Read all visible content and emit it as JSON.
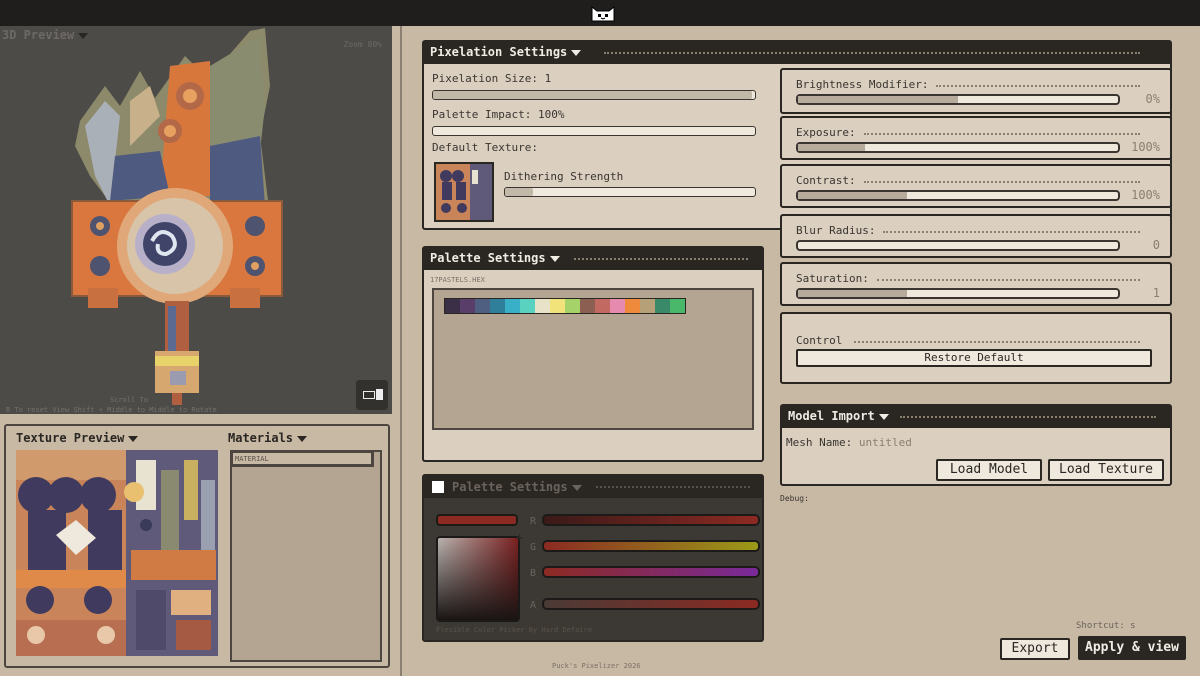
{
  "preview3d": {
    "title": "3D Preview",
    "zoom": "Zoom 80%",
    "hint_line1": "Scroll To",
    "hint_line2": "R To reset View   Shift + Middle to     Middle to Rotate"
  },
  "texture_preview": {
    "title": "Texture Preview"
  },
  "materials": {
    "title": "Materials",
    "items": [
      "MATERIAL"
    ]
  },
  "pixelation": {
    "title": "Pixelation Settings",
    "size_label": "Pixelation Size: 1",
    "palette_impact_label": "Palette Impact: 100%",
    "default_texture_label": "Default Texture:",
    "dithering_label": "Dithering Strength",
    "size_fill": 0.99,
    "palette_fill": 0.0,
    "dither_fill": 0.11
  },
  "adjustments": [
    {
      "label": "Brightness Modifier:",
      "value": "0%",
      "fill": 0.5
    },
    {
      "label": "Exposure:",
      "value": "100%",
      "fill": 0.21
    },
    {
      "label": "Contrast:",
      "value": "100%",
      "fill": 0.34
    },
    {
      "label": "Blur Radius:",
      "value": "0",
      "fill": 0.0
    },
    {
      "label": "Saturation:",
      "value": "1",
      "fill": 0.34
    }
  ],
  "control": {
    "label": "Control",
    "restore_label": "Restore Default"
  },
  "palette": {
    "title": "Palette Settings",
    "file": "17PASTELS.HEX",
    "colors": [
      "#3b2f48",
      "#5a3e6a",
      "#4e5f82",
      "#2f7f9a",
      "#3ab0c8",
      "#59d3c0",
      "#e8e2c8",
      "#f1e27a",
      "#a5d36a",
      "#8b5f52",
      "#c26a62",
      "#e68ab0",
      "#ef8a3c",
      "#b6a078",
      "#3a8a6a",
      "#4ab86a"
    ]
  },
  "picker": {
    "title": "Palette Settings",
    "labels": {
      "r": "R",
      "g": "G",
      "b": "B",
      "a": "A"
    },
    "credit": "Flexible Color Picker By Hard Defaire"
  },
  "model_import": {
    "title": "Model Import",
    "mesh_label": "Mesh Name:",
    "mesh_value": "untitled",
    "load_model": "Load Model",
    "load_texture": "Load Texture"
  },
  "debug": "Debug:",
  "shortcut": "Shortcut: s",
  "export_label": "Export",
  "apply_label": "Apply & view",
  "footer": "Puck's Pixelizer 2026"
}
